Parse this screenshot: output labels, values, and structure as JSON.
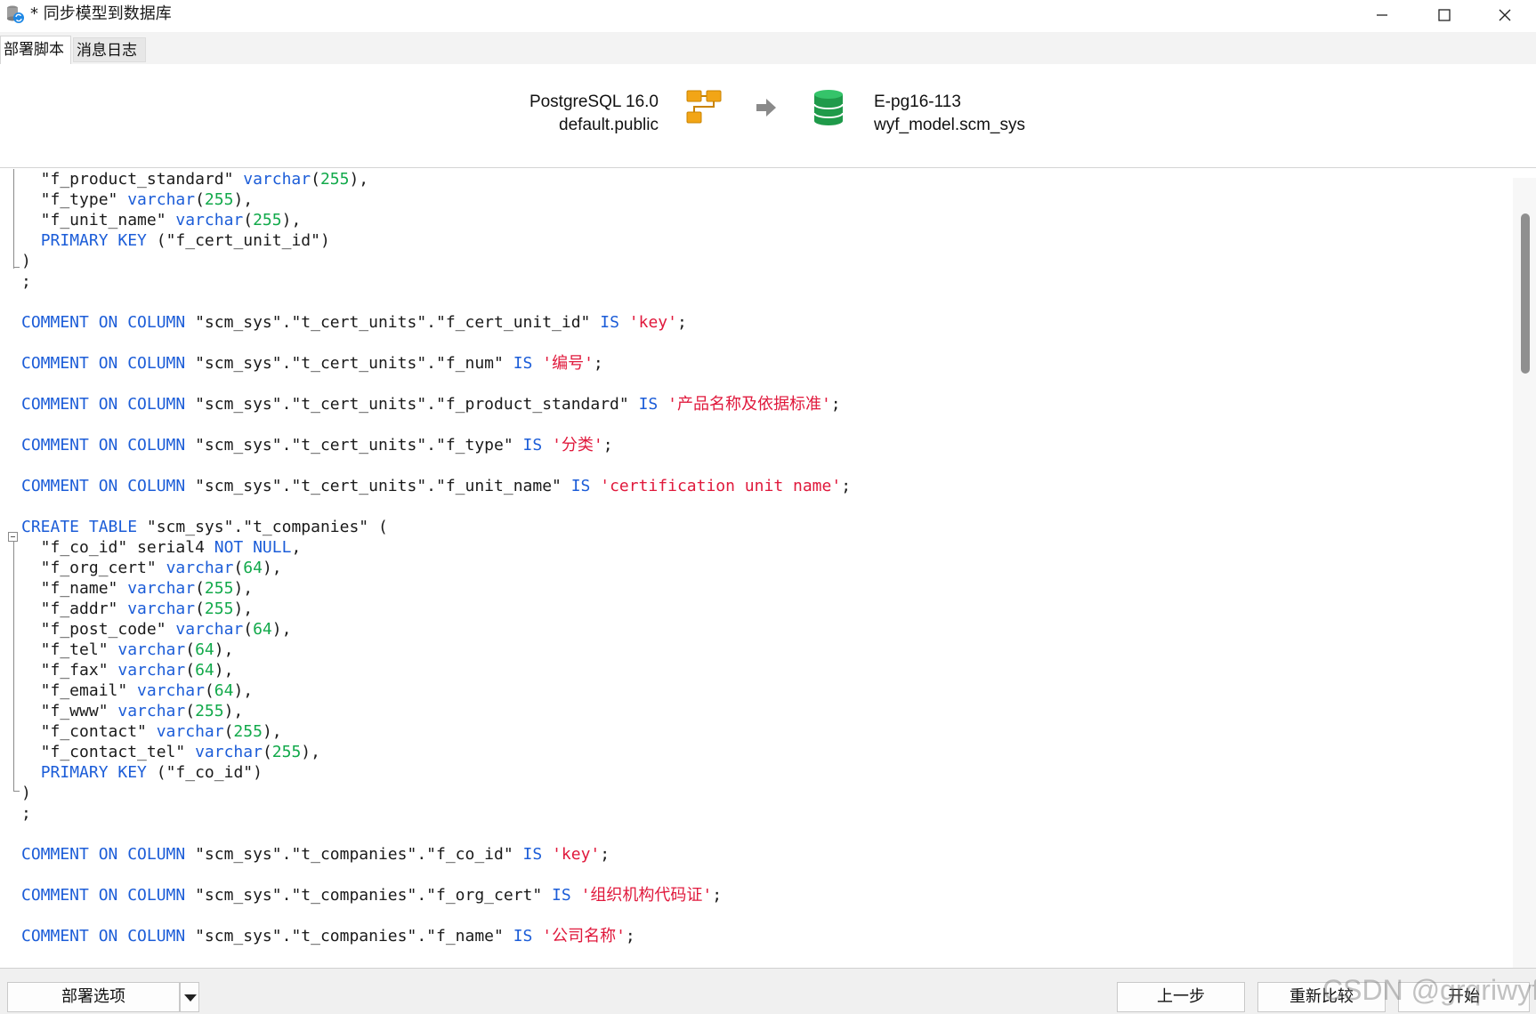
{
  "window": {
    "title": "* 同步模型到数据库",
    "controls": [
      "minimize-icon",
      "maximize-icon",
      "close-icon"
    ]
  },
  "tabs": [
    {
      "label": "部署脚本",
      "active": true
    },
    {
      "label": "消息日志",
      "active": false
    }
  ],
  "header": {
    "source": {
      "server": "PostgreSQL 16.0",
      "schema": "default.public",
      "icon": "model-tables-icon"
    },
    "arrow_icon": "arrow-right-icon",
    "target": {
      "server": "E-pg16-113",
      "schema": "wyf_model.scm_sys",
      "icon": "database-icon"
    }
  },
  "code": {
    "lines": [
      [
        {
          "t": "  \"f_product_standard\" "
        },
        {
          "t": "varchar",
          "c": "kw"
        },
        {
          "t": "("
        },
        {
          "t": "255",
          "c": "num"
        },
        {
          "t": "),"
        }
      ],
      [
        {
          "t": "  \"f_type\" "
        },
        {
          "t": "varchar",
          "c": "kw"
        },
        {
          "t": "("
        },
        {
          "t": "255",
          "c": "num"
        },
        {
          "t": "),"
        }
      ],
      [
        {
          "t": "  \"f_unit_name\" "
        },
        {
          "t": "varchar",
          "c": "kw"
        },
        {
          "t": "("
        },
        {
          "t": "255",
          "c": "num"
        },
        {
          "t": "),"
        }
      ],
      [
        {
          "t": "  "
        },
        {
          "t": "PRIMARY KEY",
          "c": "kw"
        },
        {
          "t": " (\"f_cert_unit_id\")"
        }
      ],
      [
        {
          "t": ")"
        }
      ],
      [
        {
          "t": ";"
        }
      ],
      [],
      [
        {
          "t": "COMMENT ON COLUMN",
          "c": "kw"
        },
        {
          "t": " \"scm_sys\".\"t_cert_units\".\"f_cert_unit_id\" "
        },
        {
          "t": "IS",
          "c": "kw"
        },
        {
          "t": " "
        },
        {
          "t": "'key'",
          "c": "str"
        },
        {
          "t": ";"
        }
      ],
      [],
      [
        {
          "t": "COMMENT ON COLUMN",
          "c": "kw"
        },
        {
          "t": " \"scm_sys\".\"t_cert_units\".\"f_num\" "
        },
        {
          "t": "IS",
          "c": "kw"
        },
        {
          "t": " "
        },
        {
          "t": "'编号'",
          "c": "str"
        },
        {
          "t": ";"
        }
      ],
      [],
      [
        {
          "t": "COMMENT ON COLUMN",
          "c": "kw"
        },
        {
          "t": " \"scm_sys\".\"t_cert_units\".\"f_product_standard\" "
        },
        {
          "t": "IS",
          "c": "kw"
        },
        {
          "t": " "
        },
        {
          "t": "'产品名称及依据标准'",
          "c": "str"
        },
        {
          "t": ";"
        }
      ],
      [],
      [
        {
          "t": "COMMENT ON COLUMN",
          "c": "kw"
        },
        {
          "t": " \"scm_sys\".\"t_cert_units\".\"f_type\" "
        },
        {
          "t": "IS",
          "c": "kw"
        },
        {
          "t": " "
        },
        {
          "t": "'分类'",
          "c": "str"
        },
        {
          "t": ";"
        }
      ],
      [],
      [
        {
          "t": "COMMENT ON COLUMN",
          "c": "kw"
        },
        {
          "t": " \"scm_sys\".\"t_cert_units\".\"f_unit_name\" "
        },
        {
          "t": "IS",
          "c": "kw"
        },
        {
          "t": " "
        },
        {
          "t": "'certification unit name'",
          "c": "str"
        },
        {
          "t": ";"
        }
      ],
      [],
      [
        {
          "t": "CREATE TABLE",
          "c": "kw"
        },
        {
          "t": " \"scm_sys\".\"t_companies\" ("
        }
      ],
      [
        {
          "t": "  \"f_co_id\" serial4 "
        },
        {
          "t": "NOT NULL",
          "c": "kw"
        },
        {
          "t": ","
        }
      ],
      [
        {
          "t": "  \"f_org_cert\" "
        },
        {
          "t": "varchar",
          "c": "kw"
        },
        {
          "t": "("
        },
        {
          "t": "64",
          "c": "num"
        },
        {
          "t": "),"
        }
      ],
      [
        {
          "t": "  \"f_name\" "
        },
        {
          "t": "varchar",
          "c": "kw"
        },
        {
          "t": "("
        },
        {
          "t": "255",
          "c": "num"
        },
        {
          "t": "),"
        }
      ],
      [
        {
          "t": "  \"f_addr\" "
        },
        {
          "t": "varchar",
          "c": "kw"
        },
        {
          "t": "("
        },
        {
          "t": "255",
          "c": "num"
        },
        {
          "t": "),"
        }
      ],
      [
        {
          "t": "  \"f_post_code\" "
        },
        {
          "t": "varchar",
          "c": "kw"
        },
        {
          "t": "("
        },
        {
          "t": "64",
          "c": "num"
        },
        {
          "t": "),"
        }
      ],
      [
        {
          "t": "  \"f_tel\" "
        },
        {
          "t": "varchar",
          "c": "kw"
        },
        {
          "t": "("
        },
        {
          "t": "64",
          "c": "num"
        },
        {
          "t": "),"
        }
      ],
      [
        {
          "t": "  \"f_fax\" "
        },
        {
          "t": "varchar",
          "c": "kw"
        },
        {
          "t": "("
        },
        {
          "t": "64",
          "c": "num"
        },
        {
          "t": "),"
        }
      ],
      [
        {
          "t": "  \"f_email\" "
        },
        {
          "t": "varchar",
          "c": "kw"
        },
        {
          "t": "("
        },
        {
          "t": "64",
          "c": "num"
        },
        {
          "t": "),"
        }
      ],
      [
        {
          "t": "  \"f_www\" "
        },
        {
          "t": "varchar",
          "c": "kw"
        },
        {
          "t": "("
        },
        {
          "t": "255",
          "c": "num"
        },
        {
          "t": "),"
        }
      ],
      [
        {
          "t": "  \"f_contact\" "
        },
        {
          "t": "varchar",
          "c": "kw"
        },
        {
          "t": "("
        },
        {
          "t": "255",
          "c": "num"
        },
        {
          "t": "),"
        }
      ],
      [
        {
          "t": "  \"f_contact_tel\" "
        },
        {
          "t": "varchar",
          "c": "kw"
        },
        {
          "t": "("
        },
        {
          "t": "255",
          "c": "num"
        },
        {
          "t": "),"
        }
      ],
      [
        {
          "t": "  "
        },
        {
          "t": "PRIMARY KEY",
          "c": "kw"
        },
        {
          "t": " (\"f_co_id\")"
        }
      ],
      [
        {
          "t": ")"
        }
      ],
      [
        {
          "t": ";"
        }
      ],
      [],
      [
        {
          "t": "COMMENT ON COLUMN",
          "c": "kw"
        },
        {
          "t": " \"scm_sys\".\"t_companies\".\"f_co_id\" "
        },
        {
          "t": "IS",
          "c": "kw"
        },
        {
          "t": " "
        },
        {
          "t": "'key'",
          "c": "str"
        },
        {
          "t": ";"
        }
      ],
      [],
      [
        {
          "t": "COMMENT ON COLUMN",
          "c": "kw"
        },
        {
          "t": " \"scm_sys\".\"t_companies\".\"f_org_cert\" "
        },
        {
          "t": "IS",
          "c": "kw"
        },
        {
          "t": " "
        },
        {
          "t": "'组织机构代码证'",
          "c": "str"
        },
        {
          "t": ";"
        }
      ],
      [],
      [
        {
          "t": "COMMENT ON COLUMN",
          "c": "kw"
        },
        {
          "t": " \"scm_sys\".\"t_companies\".\"f_name\" "
        },
        {
          "t": "IS",
          "c": "kw"
        },
        {
          "t": " "
        },
        {
          "t": "'公司名称'",
          "c": "str"
        },
        {
          "t": ";"
        }
      ]
    ]
  },
  "footer": {
    "deploy_options_label": "部署选项",
    "prev_label": "上一步",
    "recompare_label": "重新比较",
    "start_label": "开始"
  },
  "watermark": "CSDN @grqriwyf"
}
